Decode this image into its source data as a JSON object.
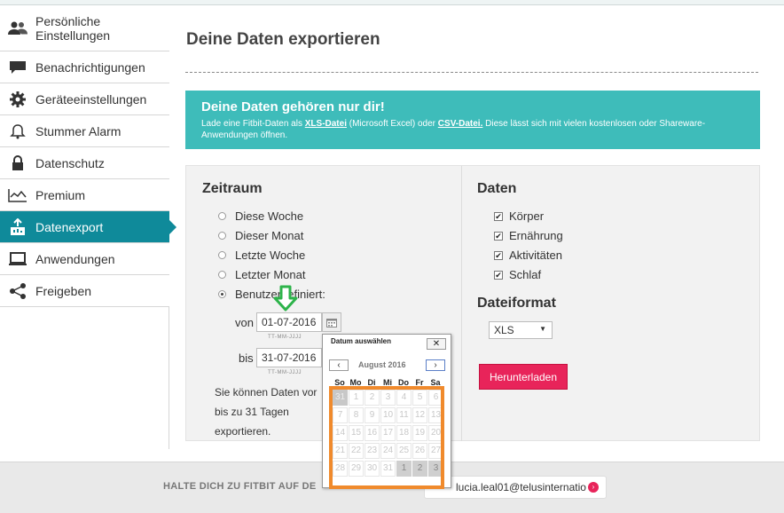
{
  "sidebar": {
    "items": [
      {
        "label": "Persönliche Einstellungen",
        "icon": "users-icon"
      },
      {
        "label": "Benachrichtigungen",
        "icon": "speech-bubble-icon"
      },
      {
        "label": "Geräteeinstellungen",
        "icon": "gear-icon"
      },
      {
        "label": "Stummer Alarm",
        "icon": "bell-icon"
      },
      {
        "label": "Datenschutz",
        "icon": "lock-icon"
      },
      {
        "label": "Premium",
        "icon": "chart-line-icon"
      },
      {
        "label": "Datenexport",
        "icon": "export-icon",
        "active": true
      },
      {
        "label": "Anwendungen",
        "icon": "laptop-icon"
      },
      {
        "label": "Freigeben",
        "icon": "share-icon"
      }
    ]
  },
  "main": {
    "title": "Deine Daten exportieren",
    "banner": {
      "title": "Deine Daten gehören nur dir!",
      "text_before": "Lade eine Fitbit-Daten als",
      "xls_link": "XLS-Datei",
      "text_mid": "(Microsoft Excel) oder",
      "csv_link": "CSV-Datei.",
      "text_after": "Diese lässt sich mit vielen kostenlosen oder Shareware-Anwendungen öffnen."
    },
    "zeitraum": {
      "title": "Zeitraum",
      "options": [
        "Diese Woche",
        "Dieser Monat",
        "Letzte Woche",
        "Letzter Monat",
        "Benutzerdefiniert:"
      ],
      "selected_index": 4,
      "von_label": "von",
      "von_value": "01-07-2016",
      "bis_label": "bis",
      "bis_value": "31-07-2016",
      "date_hint": "TT-MM-JJJJ",
      "note_lines": [
        "Sie können Daten vor",
        "bis zu 31 Tagen",
        "exportieren."
      ]
    },
    "daten": {
      "title": "Daten",
      "options": [
        "Körper",
        "Ernährung",
        "Aktivitäten",
        "Schlaf"
      ],
      "checked": [
        true,
        true,
        true,
        true
      ]
    },
    "dateiformat": {
      "title": "Dateiformat",
      "selected": "XLS"
    },
    "download_label": "Herunterladen"
  },
  "datepicker": {
    "header": "Datum auswählen",
    "close": "✕",
    "prev": "‹",
    "next": "›",
    "month": "August 2016",
    "weekdays": [
      "So",
      "Mo",
      "Di",
      "Mi",
      "Do",
      "Fr",
      "Sa"
    ],
    "weeks": [
      [
        "31",
        "1",
        "2",
        "3",
        "4",
        "5",
        "6"
      ],
      [
        "7",
        "8",
        "9",
        "10",
        "11",
        "12",
        "13"
      ],
      [
        "14",
        "15",
        "16",
        "17",
        "18",
        "19",
        "20"
      ],
      [
        "21",
        "22",
        "23",
        "24",
        "25",
        "26",
        "27"
      ],
      [
        "28",
        "29",
        "30",
        "31",
        "1",
        "2",
        "3"
      ]
    ]
  },
  "footer": {
    "text": "HALTE DICH ZU FITBIT AUF DE",
    "email": "lucia.leal01@telusinternatio"
  },
  "colors": {
    "accent": "#0f8a9a",
    "banner": "#3ebcba",
    "download": "#e8245a",
    "highlight": "#f08a2c",
    "arrow": "#2db34a"
  }
}
